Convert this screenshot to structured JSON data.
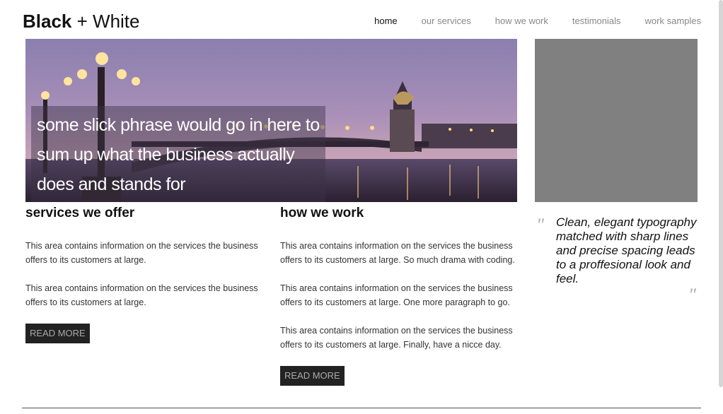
{
  "header": {
    "logo_bold": "Black",
    "logo_plus": " + ",
    "logo_light": "White",
    "nav": [
      {
        "label": "home",
        "active": true
      },
      {
        "label": "our services",
        "active": false
      },
      {
        "label": "how we work",
        "active": false
      },
      {
        "label": "testimonials",
        "active": false
      },
      {
        "label": "work samples",
        "active": false
      }
    ]
  },
  "hero": {
    "caption": "some slick phrase would go in here to sum up what the business actually does and stands for",
    "image": "bridge-at-dusk-photo"
  },
  "services": {
    "title": "services we offer",
    "paragraphs": [
      "This area contains information on the services the business offers to its customers at large.",
      "This area contains information on the services the business offers to its customers at large."
    ],
    "button": "READ MORE"
  },
  "how_we_work": {
    "title": "how we work",
    "paragraphs": [
      "This area contains information on the services the business offers to its customers at large. So much drama with coding.",
      "This area contains information on the services the business offers to its customers at large. One more paragraph to go.",
      "This area contains information on the services the business offers to its customers at large. Finally, have a nicce day."
    ],
    "button": "READ MORE"
  },
  "quote": {
    "open_mark": "\"",
    "close_mark": "\"",
    "text": "Clean, elegant typography matched with sharp lines and precise spacing leads to a proffesional look and feel."
  },
  "colors": {
    "side_box": "#808080",
    "button_bg": "#222222",
    "nav_inactive": "#888888"
  }
}
